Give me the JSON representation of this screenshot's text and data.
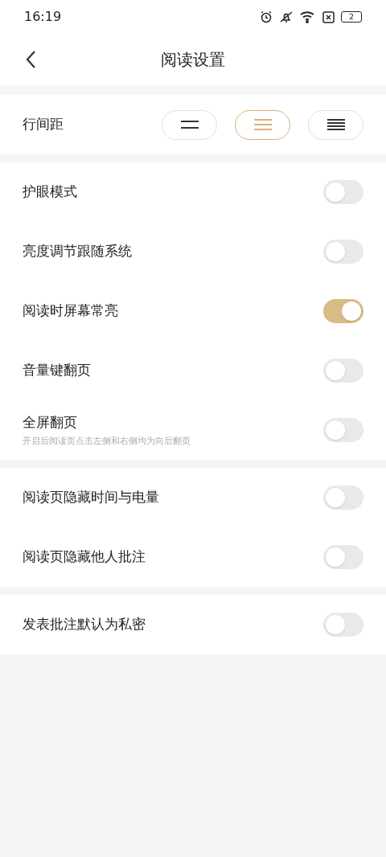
{
  "status_bar": {
    "time": "16:19",
    "battery": "2"
  },
  "header": {
    "title": "阅读设置"
  },
  "line_spacing": {
    "label": "行间距",
    "options": [
      {
        "selected": false
      },
      {
        "selected": true
      },
      {
        "selected": false
      }
    ]
  },
  "groups": [
    [
      {
        "label": "护眼模式",
        "on": false
      },
      {
        "label": "亮度调节跟随系统",
        "on": false
      },
      {
        "label": "阅读时屏幕常亮",
        "on": true
      },
      {
        "label": "音量键翻页",
        "on": false
      },
      {
        "label": "全屏翻页",
        "hint": "开启后阅读页点击左侧和右侧均为向后翻页",
        "on": false
      }
    ],
    [
      {
        "label": "阅读页隐藏时间与电量",
        "on": false
      },
      {
        "label": "阅读页隐藏他人批注",
        "on": false
      }
    ],
    [
      {
        "label": "发表批注默认为私密",
        "on": false
      }
    ]
  ]
}
